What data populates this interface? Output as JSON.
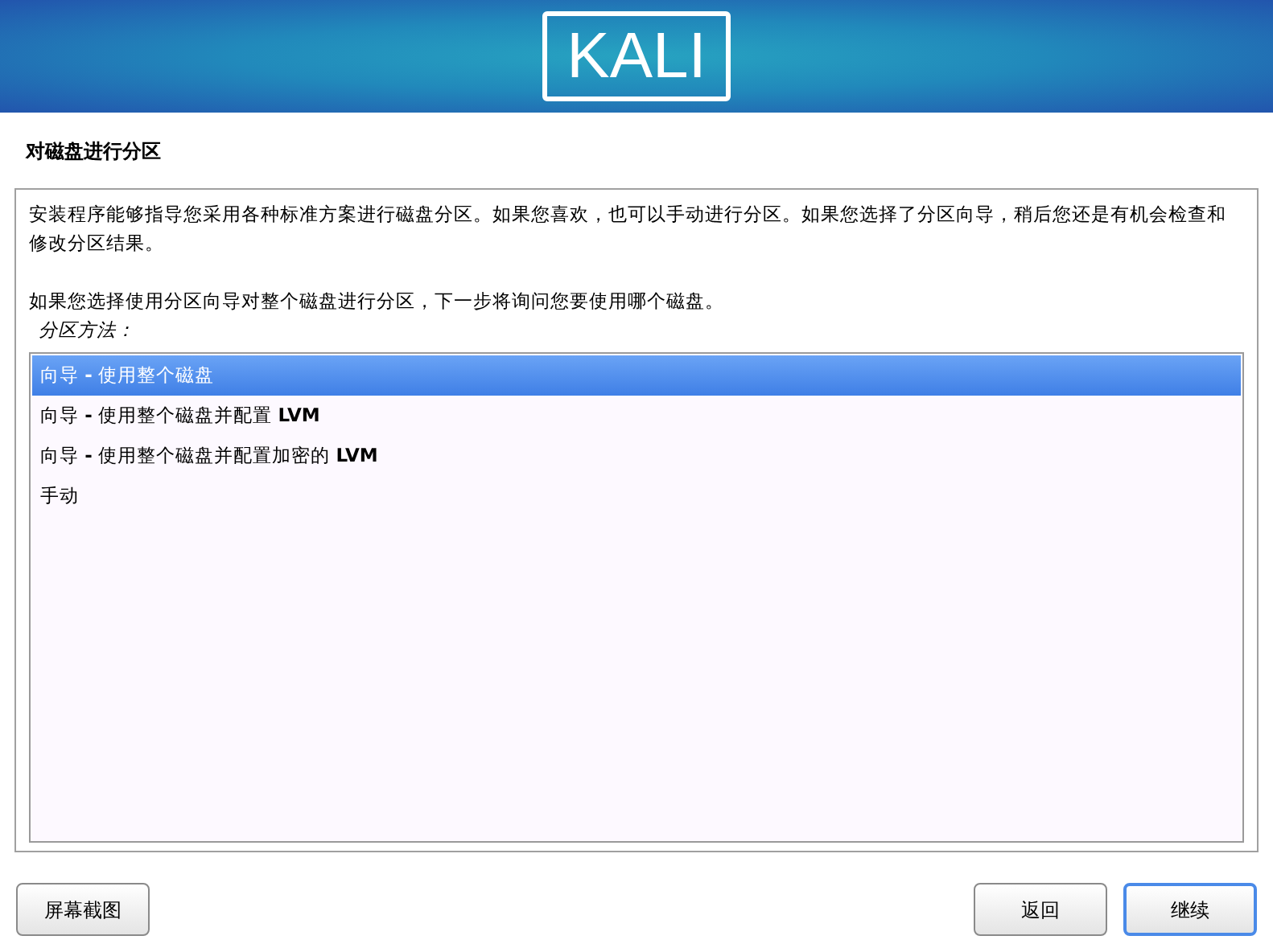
{
  "header": {
    "logo": "KALI"
  },
  "page_title": "对磁盘进行分区",
  "paragraphs": [
    "安装程序能够指导您采用各种标准方案进行磁盘分区。如果您喜欢，也可以手动进行分区。如果您选择了分区向导，稍后您还是有机会检查和修改分区结果。",
    "如果您选择使用分区向导对整个磁盘进行分区，下一步将询问您要使用哪个磁盘。"
  ],
  "list_label": "分区方法：",
  "options": [
    {
      "label": "向导 **-** 使用整个磁盘",
      "selected": true
    },
    {
      "label": "向导 **-** 使用整个磁盘并配置 **LVM**",
      "selected": false
    },
    {
      "label": "向导 **-** 使用整个磁盘并配置加密的 **LVM**",
      "selected": false
    },
    {
      "label": "手动",
      "selected": false
    }
  ],
  "buttons": {
    "screenshot": "屏幕截图",
    "back": "返回",
    "continue": "继续"
  }
}
